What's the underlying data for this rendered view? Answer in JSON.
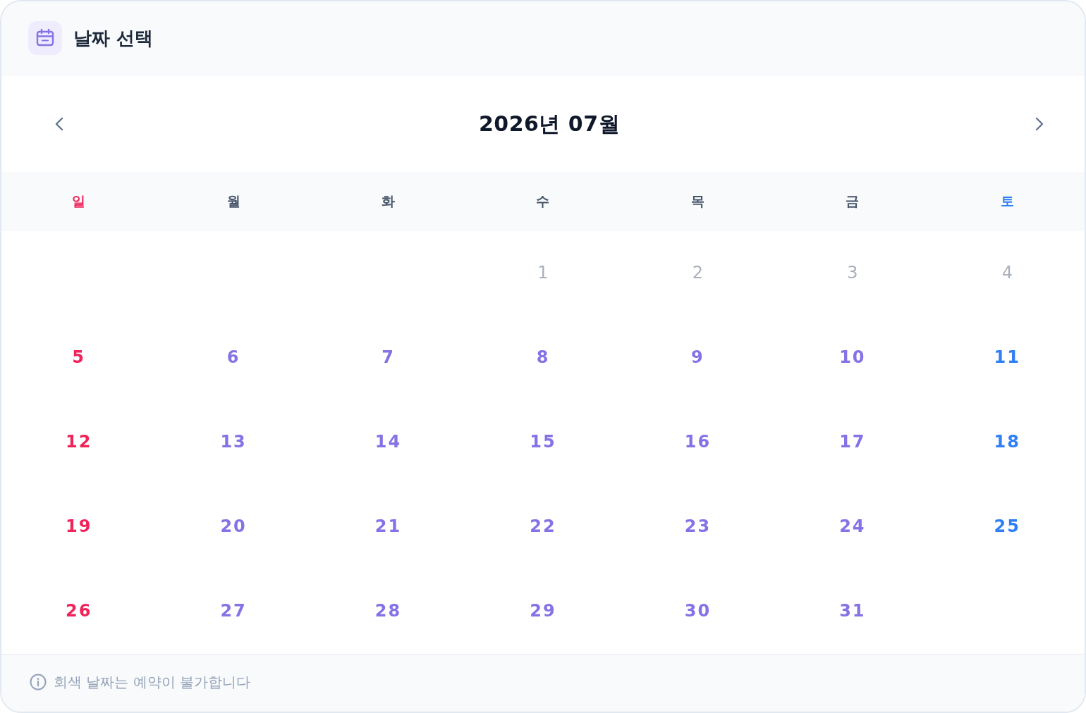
{
  "header": {
    "title": "날짜 선택"
  },
  "calendar": {
    "month_title": "2026년 07월",
    "weekdays": [
      {
        "label": "일",
        "kind": "sunday"
      },
      {
        "label": "월",
        "kind": "weekday"
      },
      {
        "label": "화",
        "kind": "weekday"
      },
      {
        "label": "수",
        "kind": "weekday"
      },
      {
        "label": "목",
        "kind": "weekday"
      },
      {
        "label": "금",
        "kind": "weekday"
      },
      {
        "label": "토",
        "kind": "saturday"
      }
    ],
    "weeks": [
      {
        "align_end": true,
        "days": [
          {
            "day": "1",
            "disabled": true
          },
          {
            "day": "2",
            "disabled": true
          },
          {
            "day": "3",
            "disabled": true
          },
          {
            "day": "4",
            "disabled": true
          }
        ]
      },
      {
        "days": [
          {
            "day": "5",
            "disabled": false
          },
          {
            "day": "6",
            "disabled": false
          },
          {
            "day": "7",
            "disabled": false
          },
          {
            "day": "8",
            "disabled": false
          },
          {
            "day": "9",
            "disabled": false
          },
          {
            "day": "10",
            "disabled": false
          },
          {
            "day": "11",
            "disabled": false
          }
        ]
      },
      {
        "days": [
          {
            "day": "12",
            "disabled": false
          },
          {
            "day": "13",
            "disabled": false
          },
          {
            "day": "14",
            "disabled": false
          },
          {
            "day": "15",
            "disabled": false
          },
          {
            "day": "16",
            "disabled": false
          },
          {
            "day": "17",
            "disabled": false
          },
          {
            "day": "18",
            "disabled": false
          }
        ]
      },
      {
        "days": [
          {
            "day": "19",
            "disabled": false
          },
          {
            "day": "20",
            "disabled": false
          },
          {
            "day": "21",
            "disabled": false
          },
          {
            "day": "22",
            "disabled": false
          },
          {
            "day": "23",
            "disabled": false
          },
          {
            "day": "24",
            "disabled": false
          },
          {
            "day": "25",
            "disabled": false
          }
        ]
      },
      {
        "align_end": false,
        "days": [
          {
            "day": "26",
            "disabled": false
          },
          {
            "day": "27",
            "disabled": false
          },
          {
            "day": "28",
            "disabled": false
          },
          {
            "day": "29",
            "disabled": false
          },
          {
            "day": "30",
            "disabled": false
          },
          {
            "day": "31",
            "disabled": false
          }
        ]
      }
    ]
  },
  "footer": {
    "note": "회색 날짜는 예약이 불가합니다"
  }
}
